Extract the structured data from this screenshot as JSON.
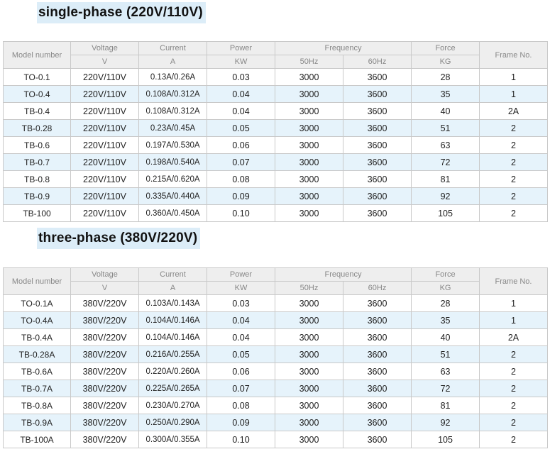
{
  "single_phase": {
    "title": "single-phase (220V/110V)",
    "header": {
      "model": "Model number",
      "voltage": "Voltage",
      "voltage_unit": "V",
      "current": "Current",
      "current_unit": "A",
      "power": "Power",
      "power_unit": "KW",
      "frequency": "Frequency",
      "freq_50": "50Hz",
      "freq_60": "60Hz",
      "force": "Force",
      "force_unit": "KG",
      "frame": "Frame No."
    },
    "rows": [
      {
        "model": "TO-0.1",
        "voltage": "220V/110V",
        "current": "0.13A/0.26A",
        "power": "0.03",
        "f50": "3000",
        "f60": "3600",
        "force": "28",
        "frame": "1"
      },
      {
        "model": "TO-0.4",
        "voltage": "220V/110V",
        "current": "0.108A/0.312A",
        "power": "0.04",
        "f50": "3000",
        "f60": "3600",
        "force": "35",
        "frame": "1"
      },
      {
        "model": "TB-0.4",
        "voltage": "220V/110V",
        "current": "0.108A/0.312A",
        "power": "0.04",
        "f50": "3000",
        "f60": "3600",
        "force": "40",
        "frame": "2A"
      },
      {
        "model": "TB-0.28",
        "voltage": "220V/110V",
        "current": "0.23A/0.45A",
        "power": "0.05",
        "f50": "3000",
        "f60": "3600",
        "force": "51",
        "frame": "2"
      },
      {
        "model": "TB-0.6",
        "voltage": "220V/110V",
        "current": "0.197A/0.530A",
        "power": "0.06",
        "f50": "3000",
        "f60": "3600",
        "force": "63",
        "frame": "2"
      },
      {
        "model": "TB-0.7",
        "voltage": "220V/110V",
        "current": "0.198A/0.540A",
        "power": "0.07",
        "f50": "3000",
        "f60": "3600",
        "force": "72",
        "frame": "2"
      },
      {
        "model": "TB-0.8",
        "voltage": "220V/110V",
        "current": "0.215A/0.620A",
        "power": "0.08",
        "f50": "3000",
        "f60": "3600",
        "force": "81",
        "frame": "2"
      },
      {
        "model": "TB-0.9",
        "voltage": "220V/110V",
        "current": "0.335A/0.440A",
        "power": "0.09",
        "f50": "3000",
        "f60": "3600",
        "force": "92",
        "frame": "2"
      },
      {
        "model": "TB-100",
        "voltage": "220V/110V",
        "current": "0.360A/0.450A",
        "power": "0.10",
        "f50": "3000",
        "f60": "3600",
        "force": "105",
        "frame": "2"
      }
    ]
  },
  "three_phase": {
    "title": "three-phase (380V/220V)",
    "header": {
      "model": "Model number",
      "voltage": "Voltage",
      "voltage_unit": "V",
      "current": "Current",
      "current_unit": "A",
      "power": "Power",
      "power_unit": "KW",
      "frequency": "Frequency",
      "freq_50": "50Hz",
      "freq_60": "60Hz",
      "force": "Force",
      "force_unit": "KG",
      "frame": "Frame No."
    },
    "rows": [
      {
        "model": "TO-0.1A",
        "voltage": "380V/220V",
        "current": "0.103A/0.143A",
        "power": "0.03",
        "f50": "3000",
        "f60": "3600",
        "force": "28",
        "frame": "1"
      },
      {
        "model": "TO-0.4A",
        "voltage": "380V/220V",
        "current": "0.104A/0.146A",
        "power": "0.04",
        "f50": "3000",
        "f60": "3600",
        "force": "35",
        "frame": "1"
      },
      {
        "model": "TB-0.4A",
        "voltage": "380V/220V",
        "current": "0.104A/0.146A",
        "power": "0.04",
        "f50": "3000",
        "f60": "3600",
        "force": "40",
        "frame": "2A"
      },
      {
        "model": "TB-0.28A",
        "voltage": "380V/220V",
        "current": "0.216A/0.255A",
        "power": "0.05",
        "f50": "3000",
        "f60": "3600",
        "force": "51",
        "frame": "2"
      },
      {
        "model": "TB-0.6A",
        "voltage": "380V/220V",
        "current": "0.220A/0.260A",
        "power": "0.06",
        "f50": "3000",
        "f60": "3600",
        "force": "63",
        "frame": "2"
      },
      {
        "model": "TB-0.7A",
        "voltage": "380V/220V",
        "current": "0.225A/0.265A",
        "power": "0.07",
        "f50": "3000",
        "f60": "3600",
        "force": "72",
        "frame": "2"
      },
      {
        "model": "TB-0.8A",
        "voltage": "380V/220V",
        "current": "0.230A/0.270A",
        "power": "0.08",
        "f50": "3000",
        "f60": "3600",
        "force": "81",
        "frame": "2"
      },
      {
        "model": "TB-0.9A",
        "voltage": "380V/220V",
        "current": "0.250A/0.290A",
        "power": "0.09",
        "f50": "3000",
        "f60": "3600",
        "force": "92",
        "frame": "2"
      },
      {
        "model": "TB-100A",
        "voltage": "380V/220V",
        "current": "0.300A/0.355A",
        "power": "0.10",
        "f50": "3000",
        "f60": "3600",
        "force": "105",
        "frame": "2"
      }
    ]
  },
  "colors": {
    "heading_bg": "#dcedf8",
    "header_bg": "#eeeeee",
    "alt_row_bg": "#e6f3fb",
    "border": "#c9c9c9"
  }
}
